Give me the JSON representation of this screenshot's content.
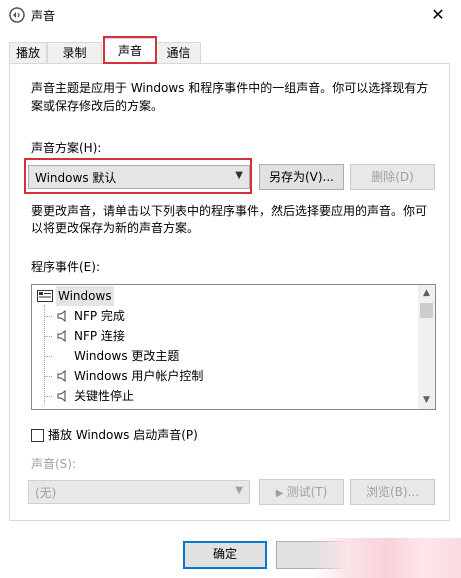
{
  "window": {
    "title": "声音",
    "close_glyph": "✕"
  },
  "tabs": [
    {
      "label": "播放"
    },
    {
      "label": "录制"
    },
    {
      "label": "声音"
    },
    {
      "label": "通信"
    }
  ],
  "description": {
    "line1": "声音主题是应用于 Windows 和程序事件中的一组声音。你可以选择现有方",
    "line2": "案或保存修改后的方案。"
  },
  "scheme": {
    "label": "声音方案(H):",
    "selected": "Windows 默认",
    "save_as_label": "另存为(V)...",
    "delete_label": "删除(D)"
  },
  "instructions": {
    "line1": "要更改声音，请单击以下列表中的程序事件，然后选择要应用的声音。你可",
    "line2": "以将更改保存为新的声音方案。"
  },
  "events": {
    "label": "程序事件(E):",
    "root": "Windows",
    "items": [
      {
        "label": "NFP 完成",
        "has_sound": true
      },
      {
        "label": "NFP 连接",
        "has_sound": true
      },
      {
        "label": "Windows 更改主题",
        "has_sound": false
      },
      {
        "label": "Windows 用户帐户控制",
        "has_sound": true
      },
      {
        "label": "关键性停止",
        "has_sound": true
      }
    ]
  },
  "startup": {
    "label": "播放 Windows 启动声音(P)",
    "checked": false
  },
  "sound": {
    "label": "声音(S):",
    "selected": "(无)",
    "test_label": "测试(T)",
    "browse_label": "浏览(B)..."
  },
  "footer": {
    "ok_label": "确定"
  },
  "colors": {
    "highlight_red": "#d0333a",
    "accent": "#0078d7"
  }
}
